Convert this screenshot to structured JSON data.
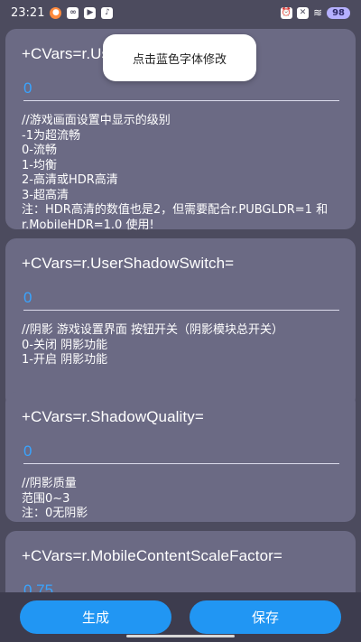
{
  "status_bar": {
    "time": "23:21",
    "battery": "98",
    "left_icons": [
      "chat-icon",
      "link-icon",
      "play-icon",
      "tiktok-icon"
    ],
    "right_icons": [
      "alarm-icon",
      "box-icon",
      "wifi-icon"
    ]
  },
  "toast": {
    "text": "点击蓝色字体修改"
  },
  "cards": [
    {
      "title": "+CVars=r.UserQualitySetting=",
      "value": "0",
      "description": "//游戏画面设置中显示的级别\n-1为超流畅\n0-流畅\n1-均衡\n2-高清或HDR高清\n3-超高清\n注：HDR高清的数值也是2，但需要配合r.PUBGLDR=1 和 r.MobileHDR=1.0 使用!"
    },
    {
      "title": "+CVars=r.UserShadowSwitch=",
      "value": "0",
      "description": "//阴影 游戏设置界面 按钮开关（阴影模块总开关）\n0-关闭 阴影功能\n1-开启 阴影功能"
    },
    {
      "title": "+CVars=r.ShadowQuality=",
      "value": "0",
      "description": "//阴影质量\n范围0~3\n注：0无阴影"
    },
    {
      "title": "+CVars=r.MobileContentScaleFactor=",
      "value": "0.75",
      "description": ""
    }
  ],
  "buttons": {
    "generate": "生成",
    "save": "保存"
  },
  "colors": {
    "background": "#4c4b5e",
    "card": "#6b6a84",
    "accent": "#2196f3",
    "value_text": "#39a4ff"
  }
}
